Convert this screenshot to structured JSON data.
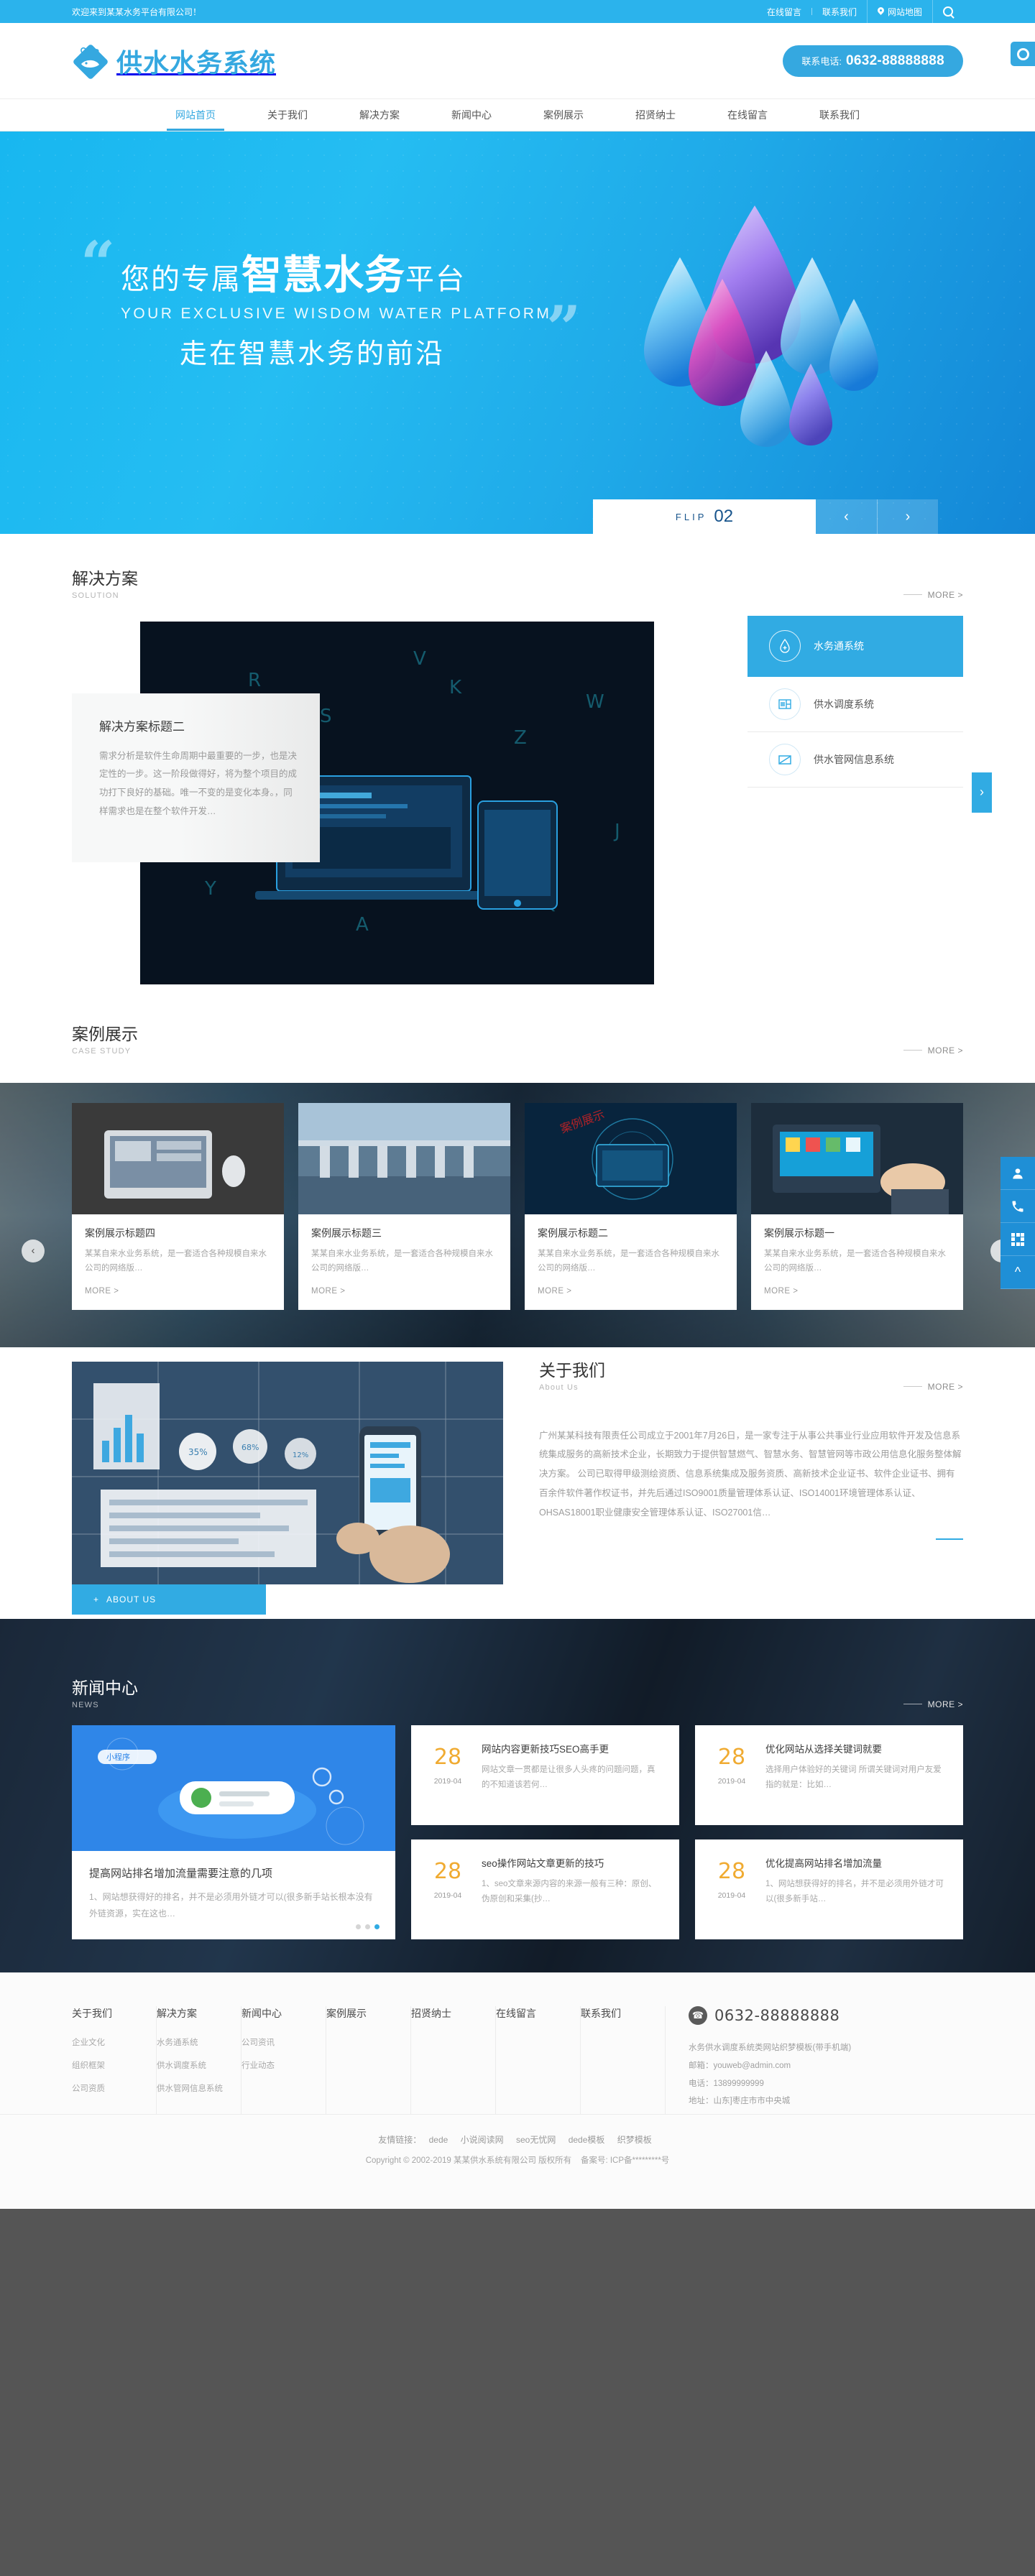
{
  "topbar": {
    "welcome": "欢迎来到某某水务平台有限公司！",
    "links": [
      {
        "label": "在线留言",
        "icon": ""
      },
      {
        "label": "联系我们",
        "icon": ""
      },
      {
        "label": "网站地图",
        "icon": "map-pin-icon"
      }
    ],
    "search_icon": "search-icon"
  },
  "header": {
    "logo_text": "供水水务系统",
    "logo_icon": "fish-diamond-logo-icon",
    "phone_label": "联系电话:",
    "phone_number": "0632-88888888",
    "corner_icon": "gear-icon"
  },
  "nav": {
    "items": [
      {
        "label": "网站首页",
        "active": true
      },
      {
        "label": "关于我们",
        "active": false
      },
      {
        "label": "解决方案",
        "active": false
      },
      {
        "label": "新闻中心",
        "active": false
      },
      {
        "label": "案例展示",
        "active": false
      },
      {
        "label": "招贤纳士",
        "active": false
      },
      {
        "label": "在线留言",
        "active": false
      },
      {
        "label": "联系我们",
        "active": false
      }
    ]
  },
  "hero": {
    "line1_a": "您的专属",
    "line1_b": "智慧水务",
    "line1_c": "平台",
    "line2": "YOUR  EXCLUSIVE  WISDOM  WATER  PLATFORM",
    "line3": "走在智慧水务的前沿",
    "quote_open": "“",
    "quote_close": "”",
    "flip_label": "FLIP",
    "flip_number": "02",
    "prev_icon": "chevron-left-icon",
    "next_icon": "chevron-right-icon"
  },
  "solution": {
    "title": "解决方案",
    "subtitle": "SOLUTION",
    "more": "MORE >",
    "card": {
      "title": "解决方案标题二",
      "text": "需求分析是软件生命周期中最重要的一步，也是决定性的一步。这一阶段做得好，将为整个项目的成功打下良好的基础。唯一不变的是变化本身。，同样需求也是在整个软件开发…"
    },
    "tabs": [
      {
        "label": "水务通系统",
        "icon": "water-drop-plus-icon",
        "active": true
      },
      {
        "label": "供水调度系统",
        "icon": "meter-panel-icon",
        "active": false
      },
      {
        "label": "供水管网信息系统",
        "icon": "pipe-network-icon",
        "active": false
      }
    ],
    "next_icon": "chevron-right-icon"
  },
  "cases": {
    "title": "案例展示",
    "subtitle": "CASE STUDY",
    "more": "MORE >",
    "prev_icon": "chevron-left-icon",
    "next_icon": "chevron-right-icon",
    "items": [
      {
        "title": "案例展示标题四",
        "desc": "某某自来水业务系统，是一套适合各种规模自来水公司的网络版…",
        "more": "MORE >"
      },
      {
        "title": "案例展示标题三",
        "desc": "某某自来水业务系统，是一套适合各种规模自来水公司的网络版…",
        "more": "MORE >"
      },
      {
        "title": "案例展示标题二",
        "desc": "某某自来水业务系统，是一套适合各种规模自来水公司的网络版…",
        "more": "MORE >"
      },
      {
        "title": "案例展示标题一",
        "desc": "某某自来水业务系统，是一套适合各种规模自来水公司的网络版…",
        "more": "MORE >"
      }
    ]
  },
  "about": {
    "title": "关于我们",
    "subtitle": "About Us",
    "more": "MORE >",
    "button_label": "ABOUT US",
    "text": "广州某某科技有限责任公司成立于2001年7月26日，是一家专注于从事公共事业行业应用软件开发及信息系统集成服务的高新技术企业，长期致力于提供智慧燃气、智慧水务、智慧管网等市政公用信息化服务整体解决方案。 公司已取得甲级测绘资质、信息系统集成及服务资质、高新技术企业证书、软件企业证书、拥有百余件软件著作权证书，并先后通过ISO9001质量管理体系认证、ISO14001环境管理体系认证、OHSAS18001职业健康安全管理体系认证、ISO27001信…"
  },
  "news": {
    "title": "新闻中心",
    "subtitle": "NEWS",
    "more": "MORE >",
    "feature": {
      "title": "提高网站排名增加流量需要注意的几项",
      "desc": "1、网站想获得好的排名，并不是必须用外链才可以(很多新手站长根本没有外链资源，实在这也…",
      "image": "illustration-phone-gears"
    },
    "items": [
      {
        "day": "28",
        "month": "2019-04",
        "title": "网站内容更新技巧SEO高手更",
        "desc": "网站文章一贯都是让很多人头疼的问题问题，真的不知道该若何…"
      },
      {
        "day": "28",
        "month": "2019-04",
        "title": "优化网站从选择关键词就要",
        "desc": "选择用户体验好的关键词 所谓关键词对用户友爱指的就是：比如…"
      },
      {
        "day": "28",
        "month": "2019-04",
        "title": "seo操作网站文章更新的技巧",
        "desc": "1、seo文章来源内容的来源一般有三种：原创、伪原创和采集(抄…"
      },
      {
        "day": "28",
        "month": "2019-04",
        "title": "优化提高网站排名增加流量",
        "desc": "1、网站想获得好的排名，并不是必须用外链才可以(很多新手站…"
      }
    ]
  },
  "footer": {
    "columns": [
      {
        "title": "关于我们",
        "links": [
          "企业文化",
          "组织框架",
          "公司资质"
        ]
      },
      {
        "title": "解决方案",
        "links": [
          "水务通系统",
          "供水调度系统",
          "供水管网信息系统"
        ]
      },
      {
        "title": "新闻中心",
        "links": [
          "公司资讯",
          "行业动态"
        ]
      },
      {
        "title": "案例展示",
        "links": []
      },
      {
        "title": "招贤纳士",
        "links": []
      },
      {
        "title": "在线留言",
        "links": []
      },
      {
        "title": "联系我们",
        "links": []
      }
    ],
    "contact": {
      "phone_icon": "phone-icon",
      "phone": "0632-88888888",
      "description": "水务供水调度系统类网站织梦模板(带手机端)",
      "email": "邮箱：youweb@admin.com",
      "tel": "电话：13899999999",
      "address": "地址：山东]枣庄市市中央城"
    },
    "friend_label": "友情链接：",
    "friend_links": [
      "dede",
      "小说阅读网",
      "seo无忧网",
      "dede模板",
      "织梦模板"
    ],
    "copyright": "Copyright © 2002-2019 某某供水系统有限公司 版权所有",
    "icp": "备案号: ICP备*********号"
  },
  "dock": {
    "items": [
      {
        "icon": "user-service-icon"
      },
      {
        "icon": "phone-icon"
      },
      {
        "icon": "qrcode-icon"
      },
      {
        "icon": "arrow-up-icon"
      }
    ]
  },
  "colors": {
    "brand": "#35a8e0",
    "brand_dark": "#1f8fd6",
    "accent_orange": "#f0ab32",
    "dark_band": "#1b2a3a"
  }
}
